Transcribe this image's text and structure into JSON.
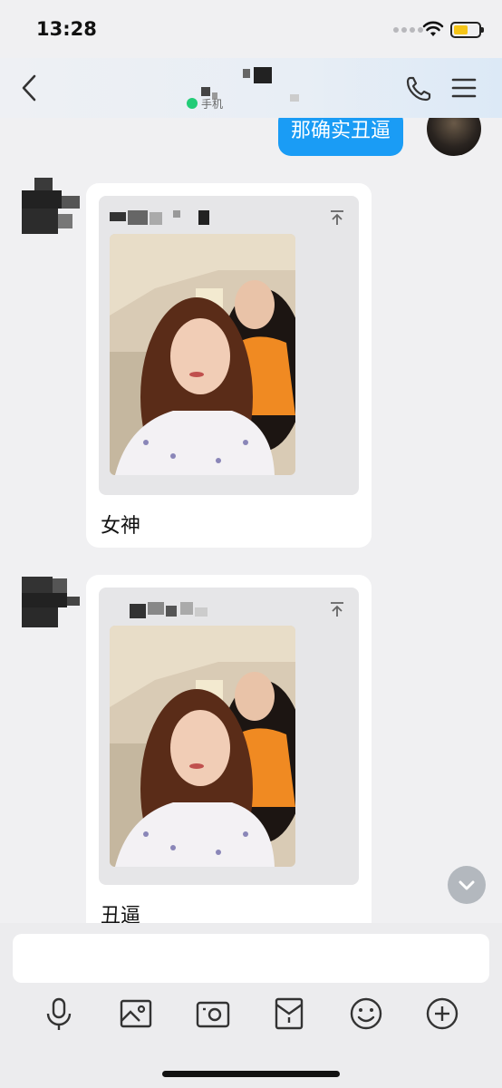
{
  "status_bar": {
    "time": "13:28",
    "battery_level": 0.58,
    "battery_color": "#f5c518"
  },
  "nav": {
    "back_icon": "chevron-left-icon",
    "subtitle": "手机",
    "online_color": "#22cc77",
    "call_icon": "phone-icon",
    "menu_icon": "menu-icon"
  },
  "chat": {
    "outgoing": {
      "text": "那确实丑逼",
      "color": "#1a9cf5"
    },
    "messages": [
      {
        "caption": "女神"
      },
      {
        "caption": "丑逼"
      }
    ],
    "scroll_icon": "chevron-down-icon"
  },
  "composer": {
    "input_value": "",
    "tools": [
      "microphone-icon",
      "image-icon",
      "camera-icon",
      "red-packet-icon",
      "emoji-icon",
      "plus-icon"
    ]
  }
}
